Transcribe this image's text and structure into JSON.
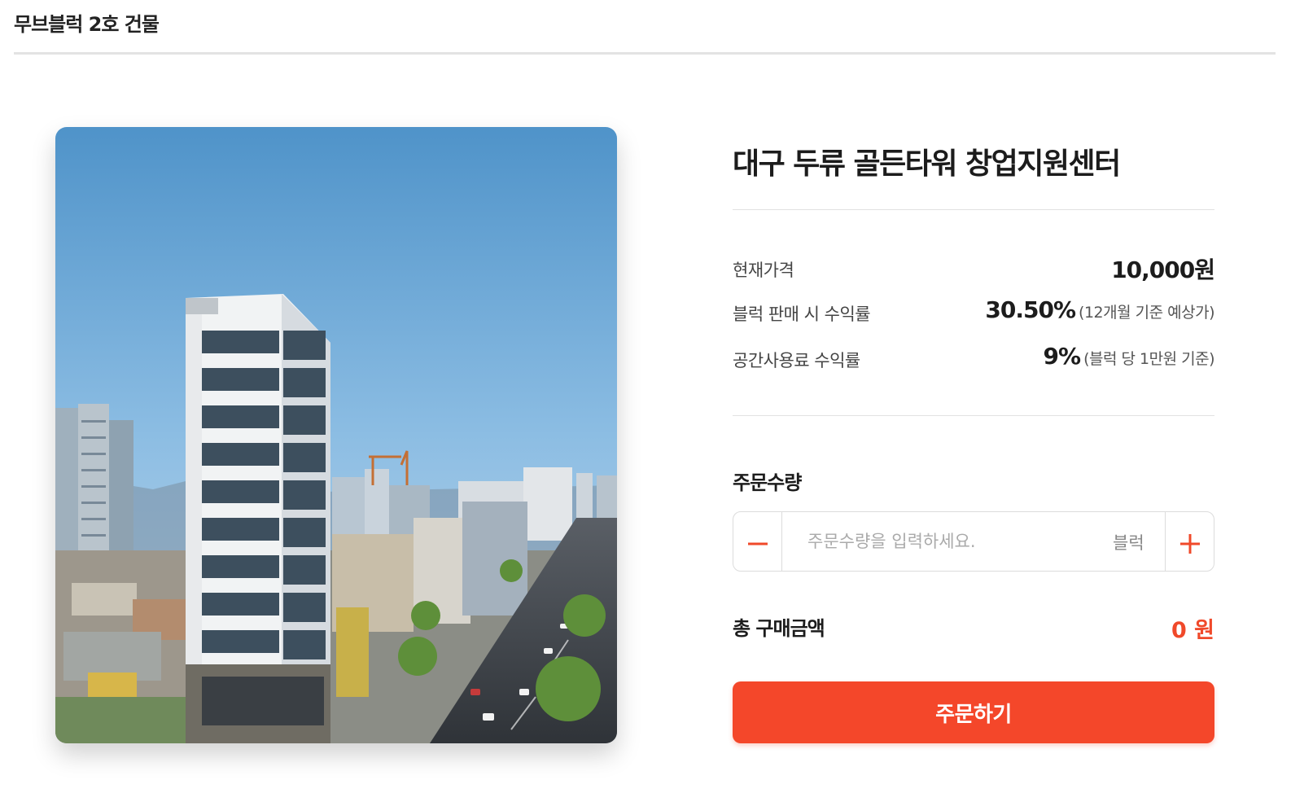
{
  "header": {
    "title": "무브블럭 2호 건물"
  },
  "product": {
    "title": "대구 두류 골든타워 창업지원센터",
    "image_icon": "building-photo"
  },
  "pricing": {
    "current_price_label": "현재가격",
    "current_price_value": "10,000원",
    "sale_yield_label": "블럭 판매 시 수익률",
    "sale_yield_value": "30.50%",
    "sale_yield_note": "(12개월 기준 예상가)",
    "space_yield_label": "공간사용료 수익률",
    "space_yield_value": "9%",
    "space_yield_note": "(블럭 당 1만원 기준)"
  },
  "order": {
    "quantity_label": "주문수량",
    "quantity_placeholder": "주문수량을 입력하세요.",
    "quantity_value": "",
    "quantity_unit": "블럭",
    "minus_icon": "minus-icon",
    "plus_icon": "plus-icon",
    "total_label": "총 구매금액",
    "total_value": "0 원",
    "order_button_label": "주문하기"
  },
  "colors": {
    "accent": "#f4472a",
    "divider": "#e2e2e2"
  }
}
